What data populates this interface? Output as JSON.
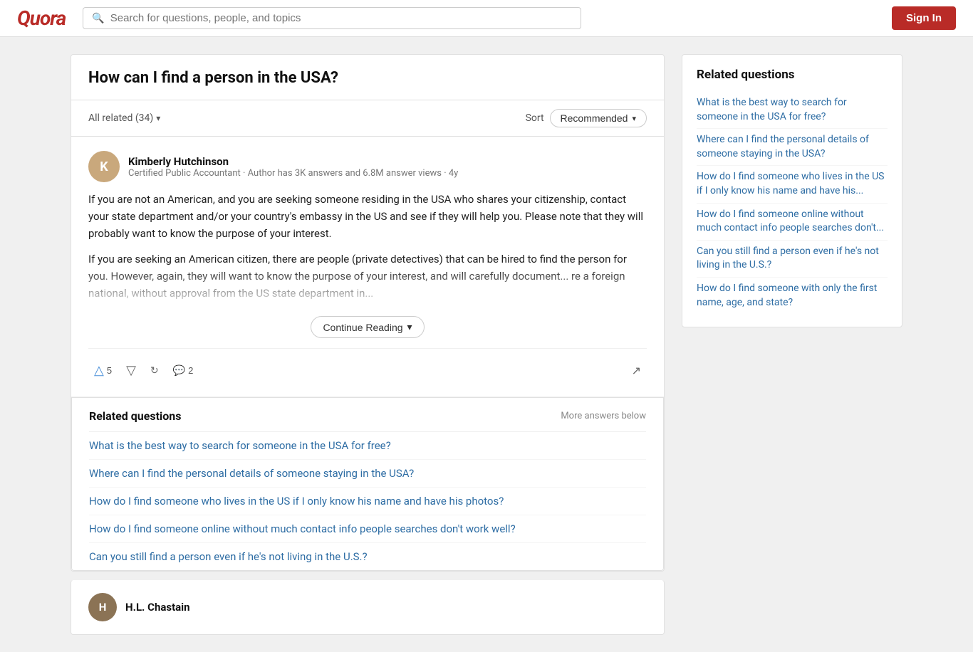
{
  "header": {
    "logo": "Quora",
    "search_placeholder": "Search for questions, people, and topics",
    "signin_label": "Sign In"
  },
  "question": {
    "title": "How can I find a person in the USA?",
    "filter_label": "All related (34)",
    "sort_label": "Sort",
    "sort_value": "Recommended"
  },
  "answer": {
    "author_name": "Kimberly Hutchinson",
    "author_meta": "Certified Public Accountant · Author has 3K answers and 6.8M answer views · 4y",
    "author_initial": "K",
    "paragraph1": "If you are not an American, and you are seeking someone residing in the USA who shares your citizenship, contact your state department and/or your country's embassy in the US and see if they will help you. Please note that they will probably want to know the purpose of your interest.",
    "paragraph2": "If you are seeking an American citizen, there are people (private detectives) that can be hired to find the person for you. However, again, they will want to know the purpose of your interest, and will carefully document... re a foreign national, without approval from the US state department in...",
    "continue_label": "Continue Reading",
    "upvote_count": "5",
    "comment_count": "2"
  },
  "related_inline": {
    "title": "Related questions",
    "more_label": "More answers below",
    "links": [
      "What is the best way to search for someone in the USA for free?",
      "Where can I find the personal details of someone staying in the USA?",
      "How do I find someone who lives in the US if I only know his name and have his photos?",
      "How do I find someone online without much contact info people searches don't work well?",
      "Can you still find a person even if he's not living in the U.S.?"
    ]
  },
  "second_author": {
    "name": "H.L. Chastain",
    "initial": "H"
  },
  "sidebar": {
    "title": "Related questions",
    "links": [
      "What is the best way to search for someone in the USA for free?",
      "Where can I find the personal details of someone staying in the USA?",
      "How do I find someone who lives in the US if I only know his name and have his...",
      "How do I find someone online without much contact info people searches don't...",
      "Can you still find a person even if he's not living in the U.S.?",
      "How do I find someone with only the first name, age, and state?"
    ]
  }
}
